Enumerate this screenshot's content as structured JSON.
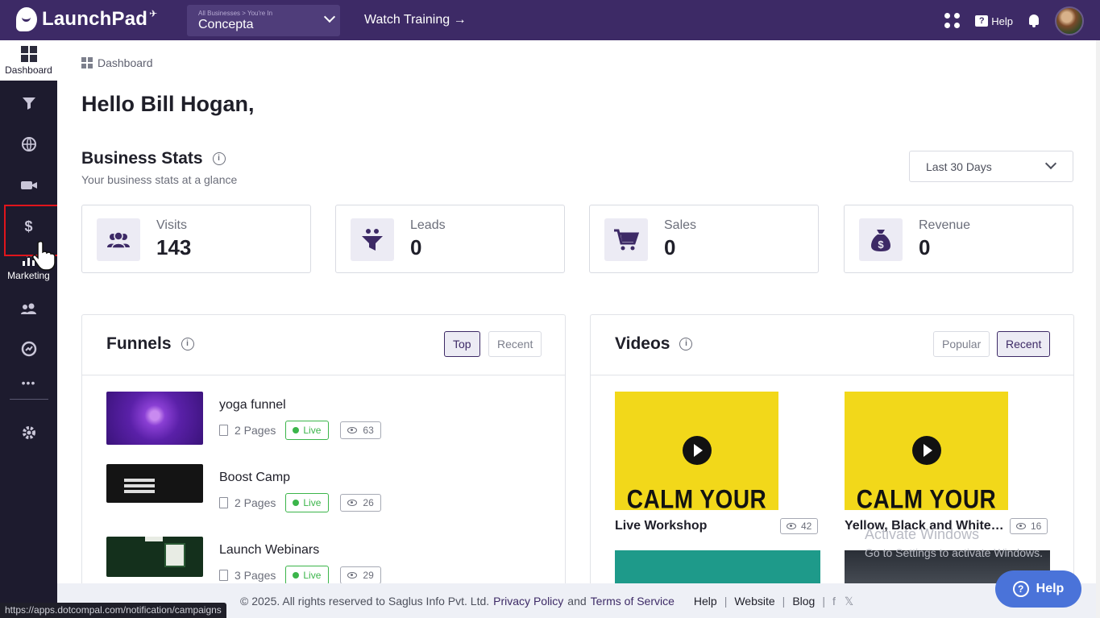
{
  "app": {
    "logo_text": "LaunchPad",
    "business_label": "All Businesses > You're In",
    "business_name": "Concepta",
    "watch_training": "Watch Training →",
    "help_label": "Help"
  },
  "sidebar": {
    "dashboard_label": "Dashboard",
    "marketing_label": "Marketing",
    "more_glyph": "•••"
  },
  "breadcrumb": "Dashboard",
  "greeting": "Hello Bill Hogan,",
  "business_stats": {
    "title": "Business Stats",
    "subtitle": "Your business stats at a glance",
    "range": "Last 30 Days",
    "cards": [
      {
        "label": "Visits",
        "value": "143",
        "icon": "users-icon"
      },
      {
        "label": "Leads",
        "value": "0",
        "icon": "funnel-icon"
      },
      {
        "label": "Sales",
        "value": "0",
        "icon": "cart-icon"
      },
      {
        "label": "Revenue",
        "value": "0",
        "icon": "money-bag-icon"
      }
    ]
  },
  "funnels": {
    "title": "Funnels",
    "tabs": [
      "Top",
      "Recent"
    ],
    "active_tab": "Top",
    "items": [
      {
        "name": "yoga funnel",
        "pages": "2 Pages",
        "status": "Live",
        "views": "63"
      },
      {
        "name": "Boost Camp",
        "pages": "2 Pages",
        "status": "Live",
        "views": "26"
      },
      {
        "name": "Launch Webinars",
        "pages": "3 Pages",
        "status": "Live",
        "views": "29"
      }
    ]
  },
  "videos": {
    "title": "Videos",
    "tabs": [
      "Popular",
      "Recent"
    ],
    "active_tab": "Recent",
    "items": [
      {
        "title": "Live Workshop",
        "thumb_text": "CALM YOUR",
        "views": "42"
      },
      {
        "title": "Yellow, Black and White M...",
        "thumb_text": "CALM YOUR",
        "views": "16"
      }
    ]
  },
  "footer": {
    "copyright": "©  2025. All rights reserved to Saglus Info Pvt. Ltd.",
    "privacy": "Privacy Policy",
    "and": "and",
    "terms": "Terms of Service",
    "help": "Help",
    "website": "Website",
    "blog": "Blog",
    "fb": "f",
    "x": "𝕏"
  },
  "status_url": "https://apps.dotcompal.com/notification/campaigns",
  "watermark": {
    "line1": "Activate Windows",
    "line2": "Go to Settings to activate Windows."
  },
  "help_fab": "Help",
  "colors": {
    "brand_purple": "#3d2a66",
    "sidebar_bg": "#1d1b2e",
    "live_green": "#3bb54a",
    "help_blue": "#4a73d9",
    "highlight_red": "#e0151c",
    "video_yellow": "#f2d81a"
  }
}
